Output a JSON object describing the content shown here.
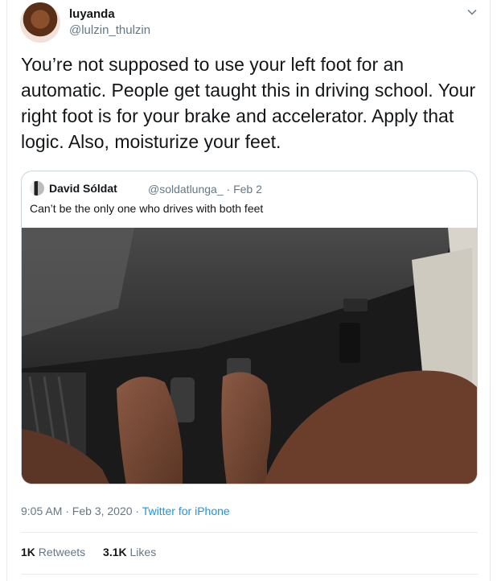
{
  "author": {
    "display_name": "luyanda",
    "handle": "@lulzin_thulzin"
  },
  "menu_icon": "chevron-down-icon",
  "tweet": {
    "text": "You’re not supposed to use your left foot for an automatic. People get taught this in driving school. Your right foot is for your brake and accelerator. Apply that logic. Also, moisturize your feet."
  },
  "quoted_tweet": {
    "display_name": "David Sóldat",
    "handle": "@soldatlunga_",
    "date": "· Feb 2",
    "text": "Can’t be the only one who drives with both feet"
  },
  "timestamp": {
    "time_date": "9:05 AM · Feb 3, 2020 ·",
    "source": "Twitter for iPhone"
  },
  "stats": {
    "retweets_count": "1K",
    "retweets_label": "Retweets",
    "likes_count": "3.1K",
    "likes_label": "Likes"
  },
  "colors": {
    "link": "#1b95e0",
    "secondary_text": "#657786",
    "border": "#ccd6dd"
  }
}
